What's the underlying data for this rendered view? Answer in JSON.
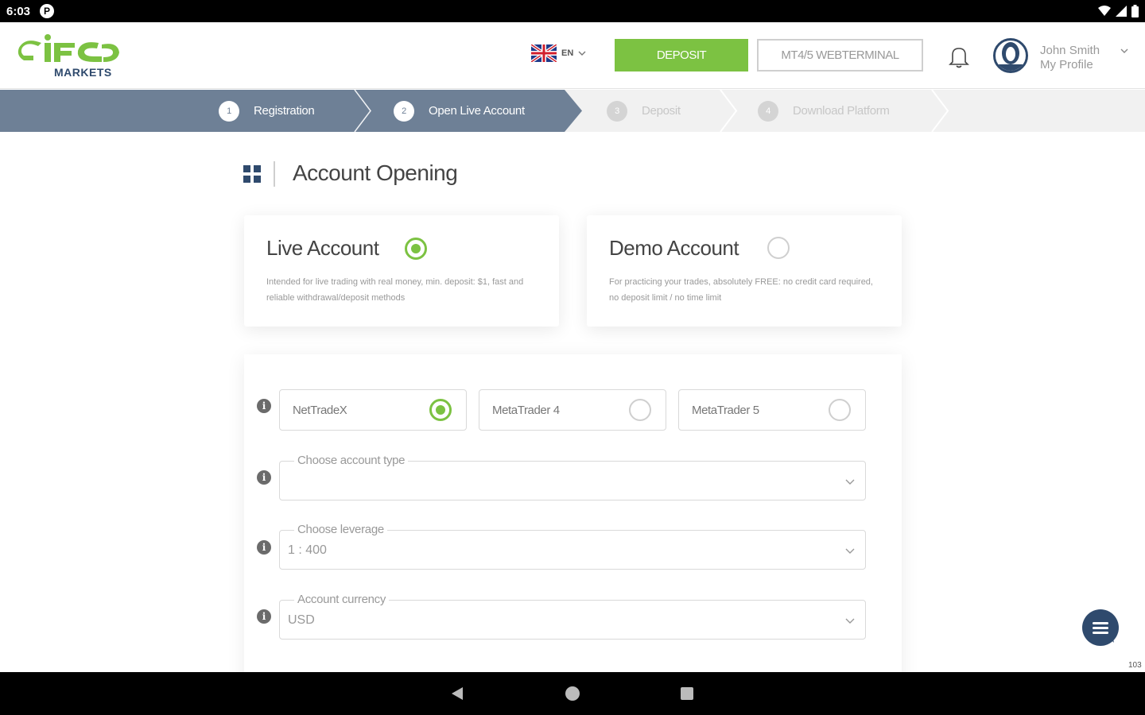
{
  "status_bar": {
    "time": "6:03",
    "notification_letter": "P"
  },
  "header": {
    "logo_alt": "IFC MARKETS",
    "language": "EN",
    "deposit_label": "DEPOSIT",
    "webterminal_label": "MT4/5 WEBTERMINAL",
    "user_name": "John Smith",
    "profile_label": "My Profile"
  },
  "stepper": {
    "steps": [
      {
        "num": "1",
        "label": "Registration",
        "active": true
      },
      {
        "num": "2",
        "label": "Open Live Account",
        "active": true
      },
      {
        "num": "3",
        "label": "Deposit",
        "active": false
      },
      {
        "num": "4",
        "label": "Download Platform",
        "active": false
      }
    ],
    "active_color": "#6e8096"
  },
  "page": {
    "title": "Account Opening"
  },
  "account_types": [
    {
      "title": "Live Account",
      "description": "Intended for live trading with real money, min. deposit: $1, fast and reliable withdrawal/deposit methods",
      "selected": true
    },
    {
      "title": "Demo Account",
      "description": "For practicing your trades, absolutely FREE: no credit card required, no deposit limit / no time limit",
      "selected": false
    }
  ],
  "platforms": [
    {
      "label": "NetTradeX",
      "selected": true
    },
    {
      "label": "MetaTrader 4",
      "selected": false
    },
    {
      "label": "MetaTrader 5",
      "selected": false
    }
  ],
  "fields": {
    "account_type": {
      "label": "Choose account type",
      "value": ""
    },
    "leverage": {
      "label": "Choose leverage",
      "value": "1 : 400"
    },
    "currency": {
      "label": "Account currency",
      "value": "USD"
    }
  },
  "corner_text": "103",
  "colors": {
    "brand_green": "#7cc242",
    "navy": "#2f4a6d"
  }
}
